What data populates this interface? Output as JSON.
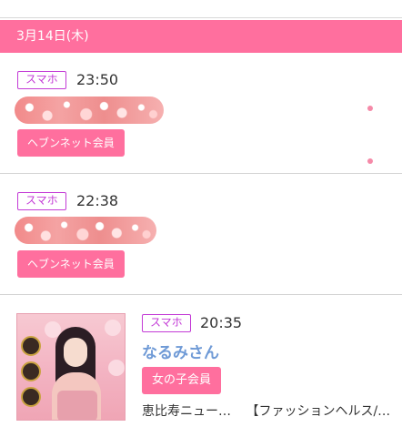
{
  "date_header": "3月14日(木)",
  "entries": [
    {
      "device": "スマホ",
      "time": "23:50",
      "member": "ヘブンネット会員"
    },
    {
      "device": "スマホ",
      "time": "22:38",
      "member": "ヘブンネット会員"
    },
    {
      "device": "スマホ",
      "time": "20:35",
      "name": "なるみさん",
      "member": "女の子会員",
      "shop_area": "恵比寿ニュー…",
      "shop_genre": "【ファッションヘルス/…"
    }
  ],
  "colors": {
    "accent": "#ff6f9e",
    "device_badge": "#c33bd6",
    "name_link": "#6f9ad6"
  }
}
